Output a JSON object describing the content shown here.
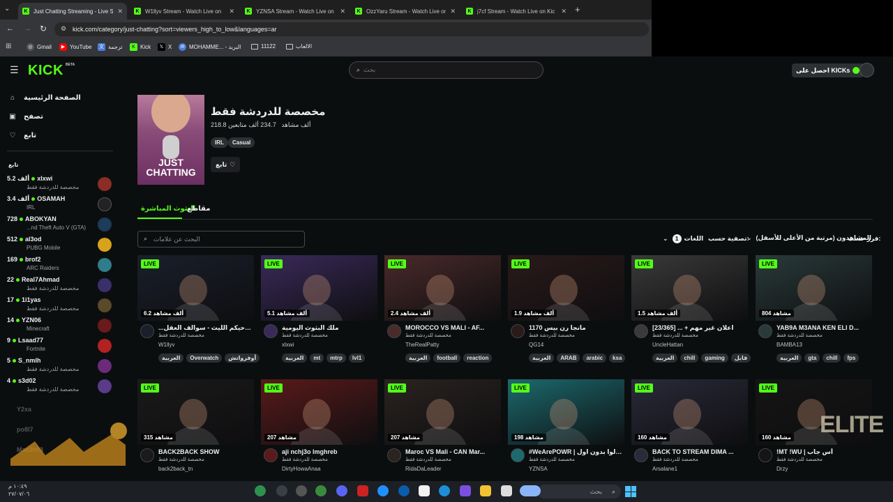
{
  "browser": {
    "tabs": [
      {
        "title": "Just Chatting Streaming - Live S",
        "active": true
      },
      {
        "title": "W1llyv Stream - Watch Live on",
        "active": false
      },
      {
        "title": "YZNSA Stream - Watch Live on",
        "active": false
      },
      {
        "title": "OzzYaru Stream - Watch Live on",
        "active": false
      },
      {
        "title": "j7cf Stream - Watch Live on Kic",
        "active": false
      }
    ],
    "url": "kick.com/category/just-chatting?sort=viewers_high_to_low&languages=ar",
    "bookmarks": [
      "Gmail",
      "YouTube",
      "ترجمة",
      "Kick",
      "X",
      "MOHAMME... - البريد",
      "11122",
      "الالعاب"
    ]
  },
  "header": {
    "logo": "KICK",
    "beta": "BETA",
    "search_placeholder": "بحث",
    "get_kicks": "احصل على KICKs"
  },
  "sidebar": {
    "nav": [
      "الصفحة الرئيسية",
      "تصفح",
      "تابع"
    ],
    "section_title": "تابع",
    "following": [
      {
        "count": "5.2 ألف",
        "name": "xlxwi",
        "category": "مخصصة للدردشة فقط",
        "color": "#8b2d24"
      },
      {
        "count": "3.4 ألف",
        "name": "OSAMAH",
        "category": "IRL",
        "color": "#222222"
      },
      {
        "count": "728",
        "name": "ABOKYAN",
        "category": "...nd Theft Auto V (GTA)",
        "color": "#1d3b5a"
      },
      {
        "count": "512",
        "name": "al3od",
        "category": "PUBG Mobile",
        "color": "#d9a21b"
      },
      {
        "count": "169",
        "name": "brof2",
        "category": "ARC Raiders",
        "color": "#2f7d8a"
      },
      {
        "count": "22",
        "name": "Real7Ahmad",
        "category": "مخصصة للدردشة فقط",
        "color": "#3a2f6b"
      },
      {
        "count": "17",
        "name": "1i1yas",
        "category": "مخصصة للدردشة فقط",
        "color": "#5a4a2a"
      },
      {
        "count": "14",
        "name": "YZN06",
        "category": "Minecraft",
        "color": "#6a1a1a"
      },
      {
        "count": "9",
        "name": "Lsaad77",
        "category": "Fortnite",
        "color": "#b22222"
      },
      {
        "count": "5",
        "name": "S_nmlh",
        "category": "مخصصة للدردشة فقط",
        "color": "#6b2b7a"
      },
      {
        "count": "4",
        "name": "s3d02",
        "category": "مخصصة للدردشة فقط",
        "color": "#5a3a8a"
      }
    ],
    "offline": [
      "Y2xa",
      "po8l7",
      "Mas3h03"
    ]
  },
  "category": {
    "title": "مخصصة للدردشة فقط",
    "image_text": "JUST CHATTING",
    "followers": "234.7 ألف متابعين",
    "viewers": "218.8 ألف مشاهد",
    "tags": [
      "Casual",
      "IRL"
    ],
    "follow_button": "تابع"
  },
  "tabs": [
    "البثوث المباشرة",
    "مقاطع"
  ],
  "filters": {
    "tag_search_placeholder": "البحث عن علامات",
    "sort_label": "فرز حسب:",
    "sort_value": "المشاهدون (مرتبة من الأعلى للأسفل)",
    "filter_label": "تصفية حسب:",
    "language_label": "اللغات",
    "language_count": "1"
  },
  "streams": [
    {
      "live": "LIVE",
      "viewers": "6.2 ألف مشاهد",
      "title": "...يكم ويقول حيكم الليث - سوالف العقل",
      "category": "مخصصة للدردشة فقط",
      "channel": "W1llyv",
      "tags": [
        "أوفرواتش",
        "Overwatch",
        "العربية"
      ],
      "color": "#1a1f2b"
    },
    {
      "live": "LIVE",
      "viewers": "5.1 ألف مشاهد",
      "title": "ملك البثوث اليومية",
      "category": "مخصصة للدردشة فقط",
      "channel": "xlxwi",
      "tags": [
        "lvl1",
        "mtrp",
        "mt",
        "العربية"
      ],
      "color": "#3a2a5a"
    },
    {
      "live": "LIVE",
      "viewers": "2.4 ألف مشاهد",
      "title": "MOROCCO VS MALI - AF...",
      "category": "مخصصة للدردشة فقط",
      "channel": "TheRealPatty",
      "tags": [
        "reaction",
        "football",
        "العربية"
      ],
      "color": "#4a2a2a"
    },
    {
      "live": "LIVE",
      "viewers": "1.9 ألف مشاهد",
      "title": "1170 مانجا رن بيس",
      "category": "مخصصة للدردشة فقط",
      "channel": "QG14",
      "tags": [
        "ksa",
        "arabic",
        "ARAB",
        "العربية"
      ],
      "color": "#2a1a1a"
    },
    {
      "live": "LIVE",
      "viewers": "1.5 ألف مشاهد",
      "title": "[23/365] ... + اعلان غير مهم",
      "category": "مخصصة للدردشة فقط",
      "channel": "UncleHattan",
      "tags": [
        "قابل",
        "gaming",
        "chill",
        "العربية"
      ],
      "color": "#3a3a3a"
    },
    {
      "live": "LIVE",
      "viewers": "804 مشاهد",
      "title": "YAB9A M3ANA KEN ELI D...",
      "category": "مخصصة للدردشة فقط",
      "channel": "BAMBA13",
      "tags": [
        "fps",
        "chill",
        "gta",
        "العربية"
      ],
      "color": "#2a3a3a"
    },
    {
      "live": "LIVE",
      "viewers": "315 مشاهد",
      "title": "BACK2BACK SHOW",
      "category": "مخصصة للدردشة فقط",
      "channel": "back2back_tn",
      "tags": [],
      "color": "#1a1a1a"
    },
    {
      "live": "LIVE",
      "viewers": "207 مشاهد",
      "title": "aji nchj3o lmghreb",
      "category": "مخصصة للدردشة فقط",
      "channel": "DirtyHowaAnaa",
      "tags": [],
      "color": "#5a1a1a"
    },
    {
      "live": "LIVE",
      "viewers": "207 مشاهد",
      "title": "Maroc VS Mali - CAN Mar...",
      "category": "مخصصة للدردشة فقط",
      "channel": "RidaDaLeader",
      "tags": [],
      "color": "#2a2320"
    },
    {
      "live": "LIVE",
      "viewers": "198 مشاهد",
      "title": "#WeArePOWR | تعالوا بدون اول",
      "category": "مخصصة للدردشة فقط",
      "channel": "YZNSA",
      "tags": [],
      "color": "#1c6a6e"
    },
    {
      "live": "LIVE",
      "viewers": "160 مشاهد",
      "title": "BACK TO STREAM DIMA ...",
      "category": "مخصصة للدردشة فقط",
      "channel": "Arsalane1",
      "tags": [],
      "color": "#2a2a3a"
    },
    {
      "live": "LIVE",
      "viewers": "160 مشاهد",
      "title": "!MT !WU | أس جاب",
      "category": "مخصصة للدردشة فقط",
      "channel": "Drzy",
      "tags": [],
      "color": "#151515"
    }
  ],
  "taskbar": {
    "search_placeholder": "بحث"
  },
  "clock": {
    "time": "١٠:٤٩ م",
    "date": "٢٧/٠٧/٠٦"
  },
  "overlay": {
    "watermark_right": "ELITE"
  }
}
